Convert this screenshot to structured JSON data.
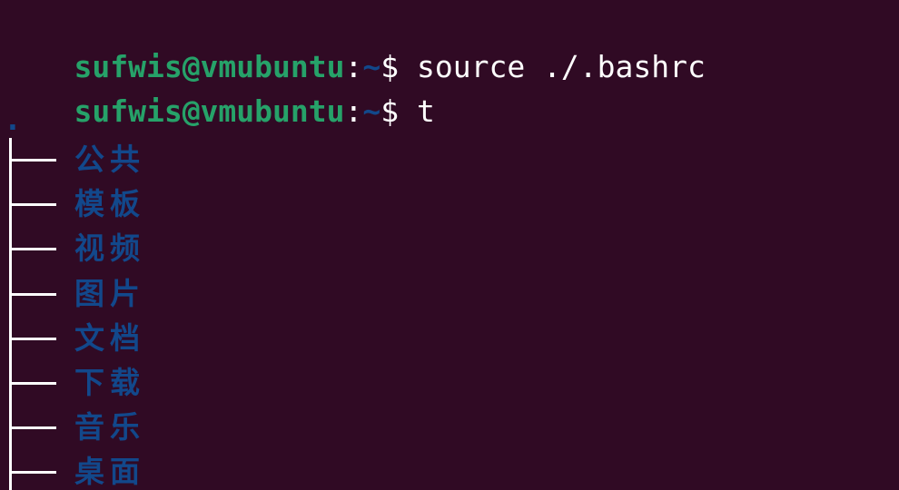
{
  "terminal": {
    "lines": [
      {
        "user_host": "sufwis@vmubuntu",
        "sep": ":",
        "path": "~",
        "dollar": "$",
        "command": " source ./.bashrc"
      },
      {
        "user_host": "sufwis@vmubuntu",
        "sep": ":",
        "path": "~",
        "dollar": "$",
        "command": " t"
      }
    ],
    "tree": {
      "root": ".",
      "entries": [
        "公共",
        "模板",
        "视频",
        "图片",
        "文档",
        "下载",
        "音乐",
        "桌面"
      ]
    }
  },
  "colors": {
    "background": "#300a24",
    "prompt_user": "#26a269",
    "prompt_path": "#12488b",
    "directory": "#12488b",
    "text": "#ffffff"
  }
}
